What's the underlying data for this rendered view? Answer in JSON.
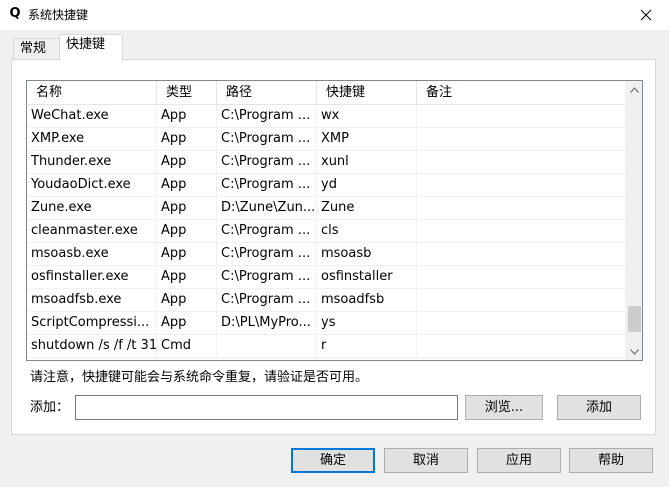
{
  "window": {
    "icon_glyph": "Q",
    "title": "系统快捷键"
  },
  "tabs": [
    {
      "label": "常规",
      "active": false
    },
    {
      "label": "快捷键",
      "active": true
    }
  ],
  "table": {
    "columns": [
      "名称",
      "类型",
      "路径",
      "快捷键",
      "备注"
    ],
    "rows": [
      [
        "WeChat.exe",
        "App",
        "C:\\Program ...",
        "wx",
        ""
      ],
      [
        "XMP.exe",
        "App",
        "C:\\Program ...",
        "XMP",
        ""
      ],
      [
        "Thunder.exe",
        "App",
        "C:\\Program ...",
        "xunl",
        ""
      ],
      [
        "YoudaoDict.exe",
        "App",
        "C:\\Program ...",
        "yd",
        ""
      ],
      [
        "Zune.exe",
        "App",
        "D:\\Zune\\Zun...",
        "Zune",
        ""
      ],
      [
        "cleanmaster.exe",
        "App",
        "C:\\Program ...",
        "cls",
        ""
      ],
      [
        "msoasb.exe",
        "App",
        "C:\\Program ...",
        "msoasb",
        ""
      ],
      [
        "osfinstaller.exe",
        "App",
        "C:\\Program ...",
        "osfinstaller",
        ""
      ],
      [
        "msoadfsb.exe",
        "App",
        "C:\\Program ...",
        "msoadfsb",
        ""
      ],
      [
        "ScriptCompressi...",
        "App",
        "D:\\PL\\MyPro...",
        "ys",
        ""
      ],
      [
        "shutdown /s /f /t 31",
        "Cmd",
        "",
        "r",
        ""
      ]
    ]
  },
  "scrollbar": {
    "position_fraction": 0.95
  },
  "notice": "请注意，快捷键可能会与系统命令重复，请验证是否可用。",
  "add": {
    "label": "添加：",
    "value": "",
    "browse_label": "浏览...",
    "add_label": "添加"
  },
  "footer": {
    "ok_label": "确定",
    "cancel_label": "取消",
    "apply_label": "应用",
    "help_label": "帮助"
  },
  "colors": {
    "accent": "#0078d7",
    "window_bg": "#f0f0f0",
    "panel_bg": "#ffffff"
  }
}
